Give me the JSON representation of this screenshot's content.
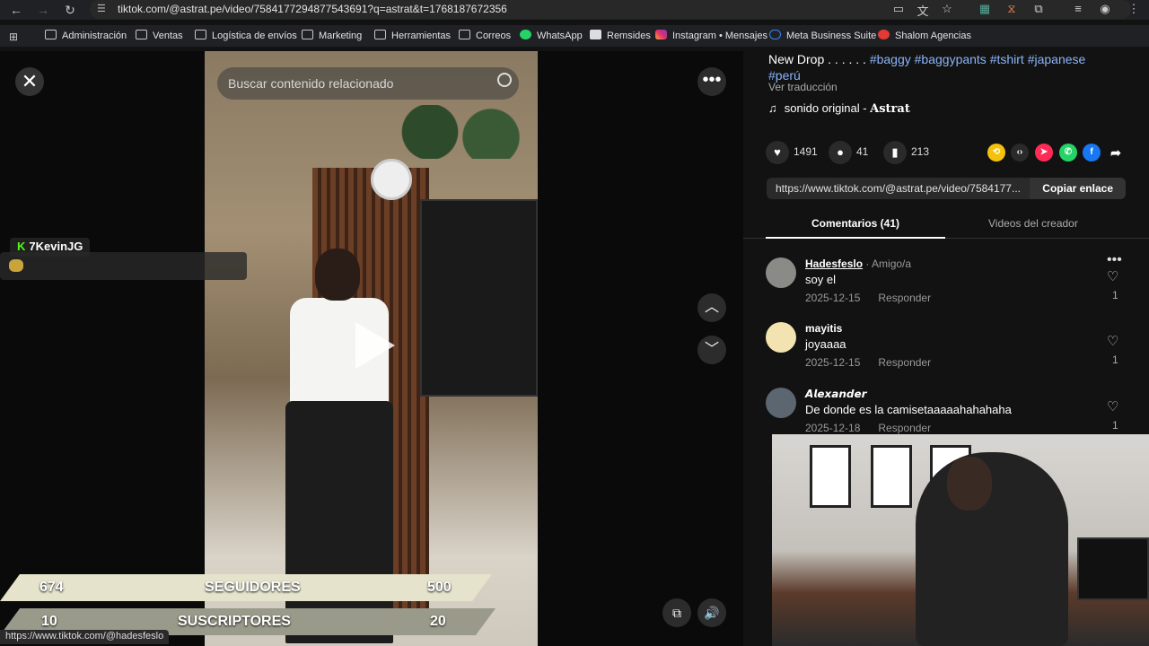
{
  "browser": {
    "url": "tiktok.com/@astrat.pe/video/7584177294877543691?q=astrat&t=1768187672356",
    "bookmarks": [
      "Administración",
      "Ventas",
      "Logística de envíos",
      "Marketing",
      "Herramientas",
      "Correos",
      "WhatsApp",
      "Remsides",
      "Instagram • Mensajes",
      "Meta Business Suite",
      "Shalom Agencias"
    ],
    "status_url": "https://www.tiktok.com/@hadesfeslo"
  },
  "video": {
    "search_placeholder": "Buscar contenido relacionado"
  },
  "stream_overlay": {
    "streamer": "7KevinJG",
    "followers_current": "674",
    "followers_label": "SEGUIDORES",
    "followers_goal": "500",
    "subs_current": "10",
    "subs_label": "SUSCRIPTORES",
    "subs_goal": "20"
  },
  "post": {
    "desc_line1": "New Drop . . . . . . ",
    "tags_line1": "#baggy #baggypants #tshirt #japanese",
    "tags_line2": "#perú",
    "translate": "Ver traducción",
    "sound_prefix": "sonido original - ",
    "sound_author": "Astrat",
    "likes": "1491",
    "comments": "41",
    "saves": "213",
    "link": "https://www.tiktok.com/@astrat.pe/video/7584177...",
    "copy_label": "Copiar enlace"
  },
  "tabs": {
    "comments": "Comentarios (41)",
    "creator_videos": "Videos del creador"
  },
  "comments": [
    {
      "user": "Hadesfeslo",
      "badge": " · Amigo/a",
      "text": "soy el",
      "date": "2025-12-15",
      "reply": "Responder",
      "likes": "1"
    },
    {
      "user": "mayitis",
      "badge": "",
      "text": "joyaaaa",
      "date": "2025-12-15",
      "reply": "Responder",
      "likes": "1"
    },
    {
      "user": "𝘼𝙡𝙚𝙭𝙖𝙣𝙙𝙚𝙧",
      "badge": "",
      "text": "De donde es la camisetaaaaahahahaha",
      "date": "2025-12-18",
      "reply": "Responder",
      "likes": "1"
    }
  ],
  "colors": {
    "accent_tag": "#8ab4f8",
    "kick_green": "#53fc18",
    "overlay_bar": "#e5e3cc"
  }
}
